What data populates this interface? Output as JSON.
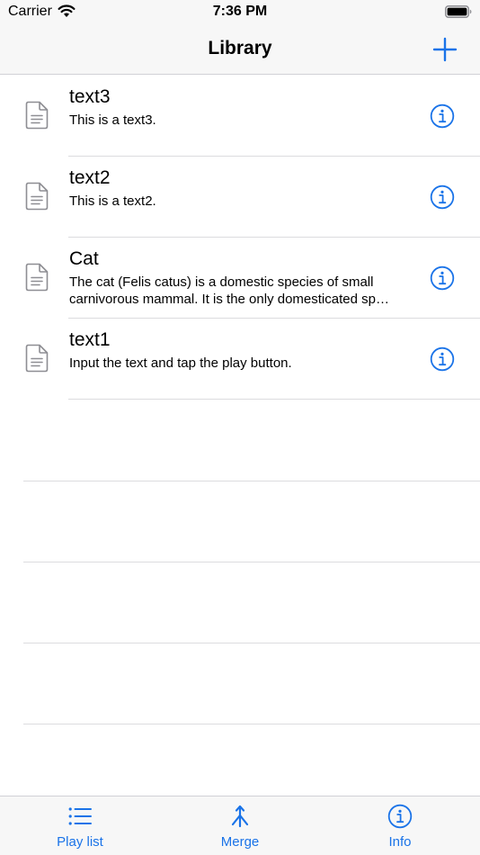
{
  "status_bar": {
    "carrier": "Carrier",
    "time": "7:36 PM"
  },
  "nav": {
    "title": "Library",
    "add_icon": "plus-icon"
  },
  "accent_color": "#1a73e8",
  "library": [
    {
      "title": "text3",
      "subtitle": "This is a text3."
    },
    {
      "title": "text2",
      "subtitle": "This is a text2."
    },
    {
      "title": "Cat",
      "subtitle": "The cat (Felis catus) is a domestic species of small carnivorous mammal. It is the only domesticated sp…"
    },
    {
      "title": "text1",
      "subtitle": "Input the text and tap the play button."
    }
  ],
  "tab_bar": {
    "items": [
      {
        "label": "Play list",
        "icon": "list-icon"
      },
      {
        "label": "Merge",
        "icon": "merge-icon"
      },
      {
        "label": "Info",
        "icon": "info-icon"
      }
    ]
  }
}
